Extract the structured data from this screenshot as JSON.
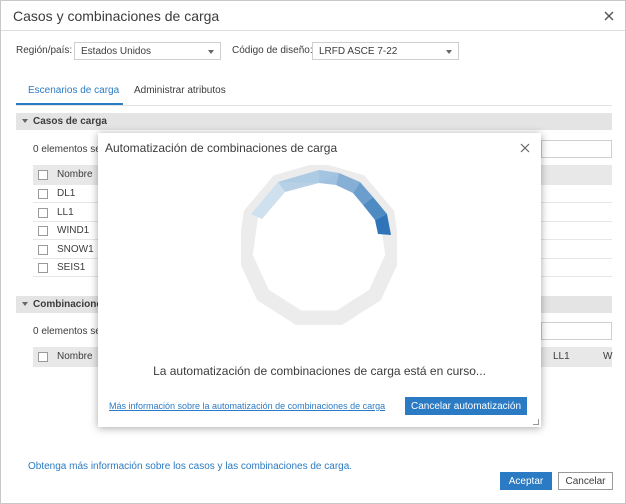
{
  "window": {
    "title": "Casos y combinaciones de carga"
  },
  "settings": {
    "region_label": "Región/país:",
    "region_value": "Estados Unidos",
    "code_label": "Código de diseño:",
    "code_value": "LRFD ASCE 7-22"
  },
  "tabs": [
    {
      "label": "Escenarios de carga",
      "active": true
    },
    {
      "label": "Administrar atributos",
      "active": false
    }
  ],
  "load_cases": {
    "header": "Casos de carga",
    "filter_text": "0 elementos sel",
    "column_name": "Nombre",
    "rows": [
      "DL1",
      "LL1",
      "WIND1",
      "SNOW1",
      "SEIS1"
    ]
  },
  "combinations": {
    "header": "Combinaciones",
    "filter_text": "0 elementos sel",
    "column_name": "Nombre",
    "col_ll1": "LL1",
    "col_w": "W"
  },
  "footer": {
    "info_link": "Obtenga más información sobre los casos y las combinaciones de carga.",
    "accept_label": "Aceptar",
    "cancel_label": "Cancelar"
  },
  "modal": {
    "title": "Automatización de combinaciones de carga",
    "message": "La automatización de combinaciones de carga está en curso...",
    "info_link": "Más información sobre la automatización de combinaciones de carga",
    "cancel_label": "Cancelar automatización"
  },
  "colors": {
    "accent": "#2b7bc4",
    "section_bg": "#e4e4e4",
    "spinner_track": "#ececec"
  }
}
